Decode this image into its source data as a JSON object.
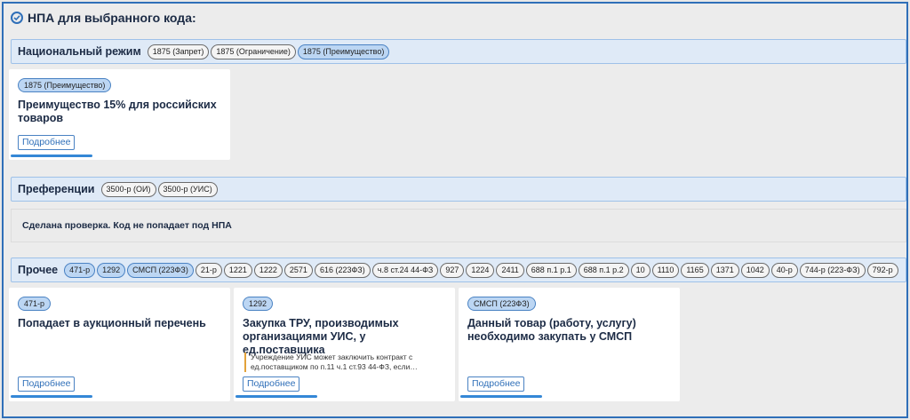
{
  "title": "НПА для выбранного кода:",
  "national": {
    "name": "Национальный режим",
    "tags": [
      "1875 (Запрет)",
      "1875 (Ограничение)",
      "1875 (Преимущество)"
    ],
    "card": {
      "tag": "1875 (Преимущество)",
      "title": "Преимущество 15% для российских товаров",
      "more": "Подробнее"
    }
  },
  "preferences": {
    "name": "Преференции",
    "tags": [
      "3500-р (ОИ)",
      "3500-р (УИС)"
    ],
    "message": "Сделана проверка. Код не попадает под НПА"
  },
  "other": {
    "name": "Прочее",
    "tags": [
      "471-р",
      "1292",
      "СМСП (223ФЗ)",
      "21-р",
      "1221",
      "1222",
      "2571",
      "616 (223ФЗ)",
      "ч.8 ст.24 44-ФЗ",
      "927",
      "1224",
      "2411",
      "688 п.1 р.1",
      "688 п.1 р.2",
      "10",
      "1110",
      "1165",
      "1371",
      "1042",
      "40-р",
      "744-р (223-ФЗ)",
      "792-р"
    ],
    "cards": [
      {
        "tag": "471-р",
        "title": "Попадает в аукционный перечень",
        "more": "Подробнее"
      },
      {
        "tag": "1292",
        "title": "Закупка ТРУ, производимых организациями УИС, у ед.поставщика",
        "note": "Учреждение УИС может заключить контракт с ед.поставщиком по п.11 ч.1 ст.93 44-ФЗ, если…",
        "more": "Подробнее"
      },
      {
        "tag": "СМСП (223ФЗ)",
        "title": "Данный товар (работу, услугу) необходимо закупать у СМСП",
        "more": "Подробнее"
      }
    ]
  },
  "colors": {
    "accent": "#2f6fb8",
    "tag_selected": "#bcd6f3",
    "section_bg": "#dfeaf7"
  }
}
